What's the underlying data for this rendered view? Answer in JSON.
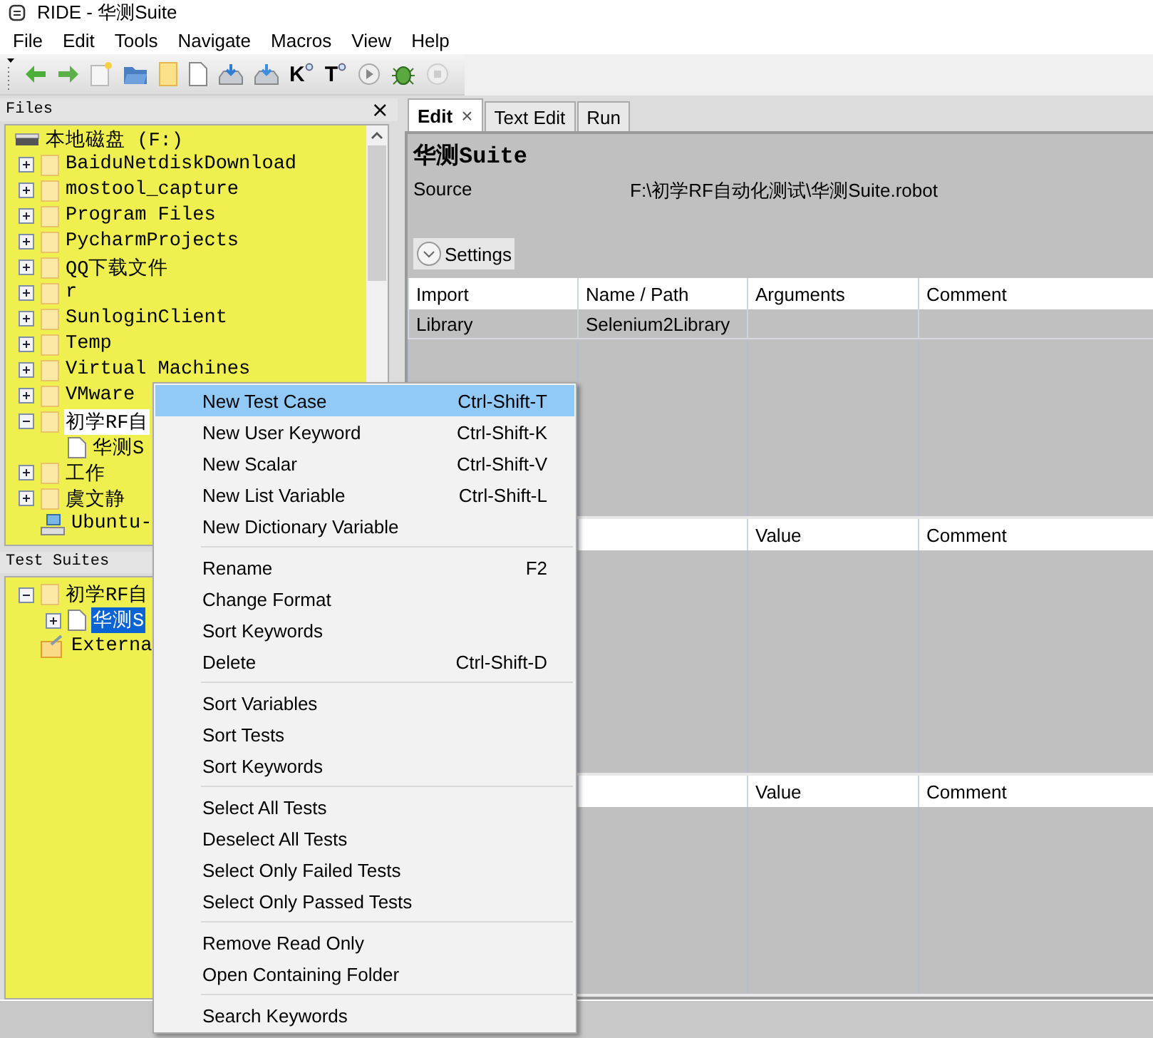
{
  "window": {
    "title": "RIDE - 华测Suite"
  },
  "menu_bar": [
    "File",
    "Edit",
    "Tools",
    "Navigate",
    "Macros",
    "View",
    "Help"
  ],
  "toolbar": [
    {
      "kind": "back"
    },
    {
      "kind": "forward"
    },
    {
      "kind": "new"
    },
    {
      "kind": "open"
    },
    {
      "kind": "folder"
    },
    {
      "kind": "page"
    },
    {
      "kind": "save"
    },
    {
      "kind": "save-all"
    },
    {
      "kind": "search",
      "glyph": "K"
    },
    {
      "kind": "search",
      "glyph": "T"
    },
    {
      "kind": "run"
    },
    {
      "kind": "debug"
    },
    {
      "kind": "stop"
    }
  ],
  "files_panel": {
    "title": "Files",
    "close": "×",
    "tree": [
      {
        "label": "本地磁盘 (F:)",
        "kind": "drive",
        "selected": false,
        "children": [
          {
            "label": "BaiduNetdiskDownload",
            "kind": "folder",
            "expanded": false,
            "selected": false
          },
          {
            "label": "mostool_capture",
            "kind": "folder",
            "expanded": false,
            "selected": false
          },
          {
            "label": "Program Files",
            "kind": "folder",
            "expanded": false,
            "selected": false
          },
          {
            "label": "PycharmProjects",
            "kind": "folder",
            "expanded": false,
            "selected": false
          },
          {
            "label": "QQ下载文件",
            "kind": "folder",
            "expanded": false,
            "selected": false
          },
          {
            "label": "r",
            "kind": "folder",
            "expanded": false,
            "selected": false
          },
          {
            "label": "SunloginClient",
            "kind": "folder",
            "expanded": false,
            "selected": false
          },
          {
            "label": "Temp",
            "kind": "folder",
            "expanded": false,
            "selected": false
          },
          {
            "label": "Virtual Machines",
            "kind": "folder",
            "expanded": false,
            "selected": false
          },
          {
            "label": "VMware",
            "kind": "folder",
            "expanded": false,
            "selected": false
          },
          {
            "label": "初学RF自",
            "kind": "folder",
            "expanded": true,
            "selected": true,
            "children": [
              {
                "label": "华测S",
                "kind": "file",
                "selected": false
              }
            ]
          },
          {
            "label": "工作",
            "kind": "folder",
            "expanded": false,
            "selected": false
          },
          {
            "label": "虞文静",
            "kind": "folder",
            "expanded": false,
            "selected": false
          },
          {
            "label": "Ubuntu-",
            "kind": "vm",
            "selected": false
          }
        ]
      }
    ]
  },
  "test_suites_panel": {
    "title": "Test Suites",
    "tree": [
      {
        "label": "初学RF自",
        "kind": "folder",
        "expanded": true,
        "selected": false,
        "children": [
          {
            "label": "华测S",
            "kind": "file",
            "expanded": false,
            "selected": true
          }
        ]
      },
      {
        "label": "Externa",
        "kind": "external",
        "selected": false
      }
    ]
  },
  "tabs": [
    {
      "label": "Edit",
      "selected": true,
      "close": "×"
    },
    {
      "label": "Text Edit",
      "selected": false
    },
    {
      "label": "Run",
      "selected": false
    }
  ],
  "editor": {
    "title": "华测Suite",
    "source_label": "Source",
    "source_value": "F:\\初学RF自动化测试\\华测Suite.robot",
    "settings_button": "Settings",
    "tables": [
      {
        "columns": [
          "Import",
          "Name / Path",
          "Arguments",
          "Comment"
        ],
        "rows": [
          [
            "Library",
            "Selenium2Library"
          ]
        ]
      },
      {
        "columns": [
          "Value",
          "Comment"
        ]
      },
      {
        "columns": [
          "Value",
          "Comment"
        ]
      }
    ]
  },
  "context_menu": [
    [
      {
        "label": "New Test Case",
        "shortcut": "Ctrl-Shift-T",
        "selected": true
      },
      {
        "label": "New User Keyword",
        "shortcut": "Ctrl-Shift-K",
        "selected": false
      },
      {
        "label": "New Scalar",
        "shortcut": "Ctrl-Shift-V",
        "selected": false
      },
      {
        "label": "New List Variable",
        "shortcut": "Ctrl-Shift-L",
        "selected": false
      },
      {
        "label": "New Dictionary Variable",
        "selected": false
      }
    ],
    [
      {
        "label": "Rename",
        "shortcut": "F2",
        "selected": false
      },
      {
        "label": "Change Format",
        "selected": false
      },
      {
        "label": "Sort Keywords",
        "selected": false
      },
      {
        "label": "Delete",
        "shortcut": "Ctrl-Shift-D",
        "selected": false
      }
    ],
    [
      {
        "label": "Sort Variables",
        "selected": false
      },
      {
        "label": "Sort Tests",
        "selected": false
      },
      {
        "label": "Sort Keywords",
        "selected": false
      }
    ],
    [
      {
        "label": "Select All Tests",
        "selected": false
      },
      {
        "label": "Deselect All Tests",
        "selected": false
      },
      {
        "label": "Select Only Failed Tests",
        "selected": false
      },
      {
        "label": "Select Only Passed Tests",
        "selected": false
      }
    ],
    [
      {
        "label": "Remove Read Only",
        "selected": false
      },
      {
        "label": "Open Containing Folder",
        "selected": false
      }
    ],
    [
      {
        "label": "Search Keywords",
        "selected": false
      }
    ]
  ]
}
